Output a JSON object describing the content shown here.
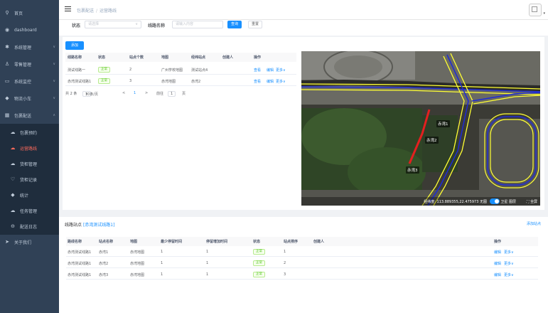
{
  "sidebar": {
    "items": [
      {
        "label": "首页",
        "icon": "location-icon",
        "arrow": false
      },
      {
        "label": "dashboard",
        "icon": "dashboard-icon",
        "arrow": false
      },
      {
        "label": "系统管理",
        "icon": "gear-icon",
        "arrow": true
      },
      {
        "label": "零售管理",
        "icon": "user-icon",
        "arrow": true
      },
      {
        "label": "系统监控",
        "icon": "monitor-icon",
        "arrow": true
      },
      {
        "label": "物流小车",
        "icon": "car-icon",
        "arrow": true
      },
      {
        "label": "包裹配送",
        "icon": "grid-icon",
        "arrow": true
      }
    ],
    "subitems": [
      {
        "label": "包裹预约",
        "icon": "cloud-icon",
        "active": false
      },
      {
        "label": "运营路线",
        "icon": "cloud-icon",
        "active": true
      },
      {
        "label": "货柜管理",
        "icon": "cloud-icon",
        "active": false
      },
      {
        "label": "货柜记录",
        "icon": "heart-icon",
        "active": false
      },
      {
        "label": "统计",
        "icon": "car-icon",
        "active": false
      },
      {
        "label": "任务管理",
        "icon": "cloud-icon",
        "active": false
      },
      {
        "label": "配送日志",
        "icon": "log-icon",
        "active": false
      }
    ],
    "bottom": {
      "label": "关于我们",
      "icon": "send-icon"
    }
  },
  "header": {
    "breadcrumb": [
      "包裹配送",
      "运营路线"
    ],
    "separator": "/"
  },
  "filters": {
    "status_label": "状态",
    "status_placeholder": "请选择",
    "route_label": "线路名称",
    "route_placeholder": "请输入内容",
    "search_btn": "查询",
    "reset_btn": "重置"
  },
  "routes": {
    "add_btn": "添加",
    "columns": [
      "线路名称",
      "状态",
      "站点个数",
      "地图",
      "经纬站点",
      "创建人",
      "操作"
    ],
    "rows": [
      {
        "name": "测试线路一",
        "status": "正常",
        "count": "2",
        "map": "广州学校地图",
        "stop": "测试站点4",
        "creator": "",
        "view": "查看",
        "edit": "编辑",
        "more": "更多∨"
      },
      {
        "name": "赤湾测试线路1",
        "status": "正常",
        "count": "3",
        "map": "赤湾地图",
        "stop": "赤湾2",
        "creator": "",
        "view": "查看",
        "edit": "编辑",
        "more": "更多∨"
      }
    ],
    "pager": {
      "total": "共 2 条",
      "page_size": "10条/页",
      "prev": "<",
      "page": "1",
      "next": ">",
      "goto": "前往",
      "goto_page": "1",
      "page_unit": "页"
    }
  },
  "map": {
    "labels": [
      "赤湾1",
      "赤湾2",
      "赤湾3"
    ],
    "coords": "经纬度: 113.889355,22.475973 无图",
    "satellite": "卫星 图层",
    "fullscreen": "⛶ 全屏"
  },
  "stops": {
    "title_prefix": "线路站点",
    "title_route": "[赤湾测试线路1]",
    "add_btn": "添加站点",
    "columns": [
      "路线名称",
      "站点名称",
      "地图",
      "最少停留时间",
      "停留增加时间",
      "状态",
      "站点排序",
      "创建人",
      "操作"
    ],
    "rows": [
      {
        "route": "赤湾测试线路1",
        "stop": "赤湾1",
        "map": "赤湾地图",
        "min_stay": "1",
        "add_stay": "1",
        "status": "正常",
        "order": "1",
        "creator": "",
        "edit": "编辑",
        "more": "更多∨"
      },
      {
        "route": "赤湾测试线路1",
        "stop": "赤湾2",
        "map": "赤湾地图",
        "min_stay": "1",
        "add_stay": "1",
        "status": "正常",
        "order": "2",
        "creator": "",
        "edit": "编辑",
        "more": "更多∨"
      },
      {
        "route": "赤湾测试线路1",
        "stop": "赤湾3",
        "map": "赤湾地图",
        "min_stay": "1",
        "add_stay": "1",
        "status": "正常",
        "order": "3",
        "creator": "",
        "edit": "编辑",
        "more": "更多∨"
      }
    ]
  },
  "colors": {
    "sidebar": "#304156",
    "primary": "#1890ff",
    "active": "#ff6a5b",
    "success": "#52c41a"
  }
}
